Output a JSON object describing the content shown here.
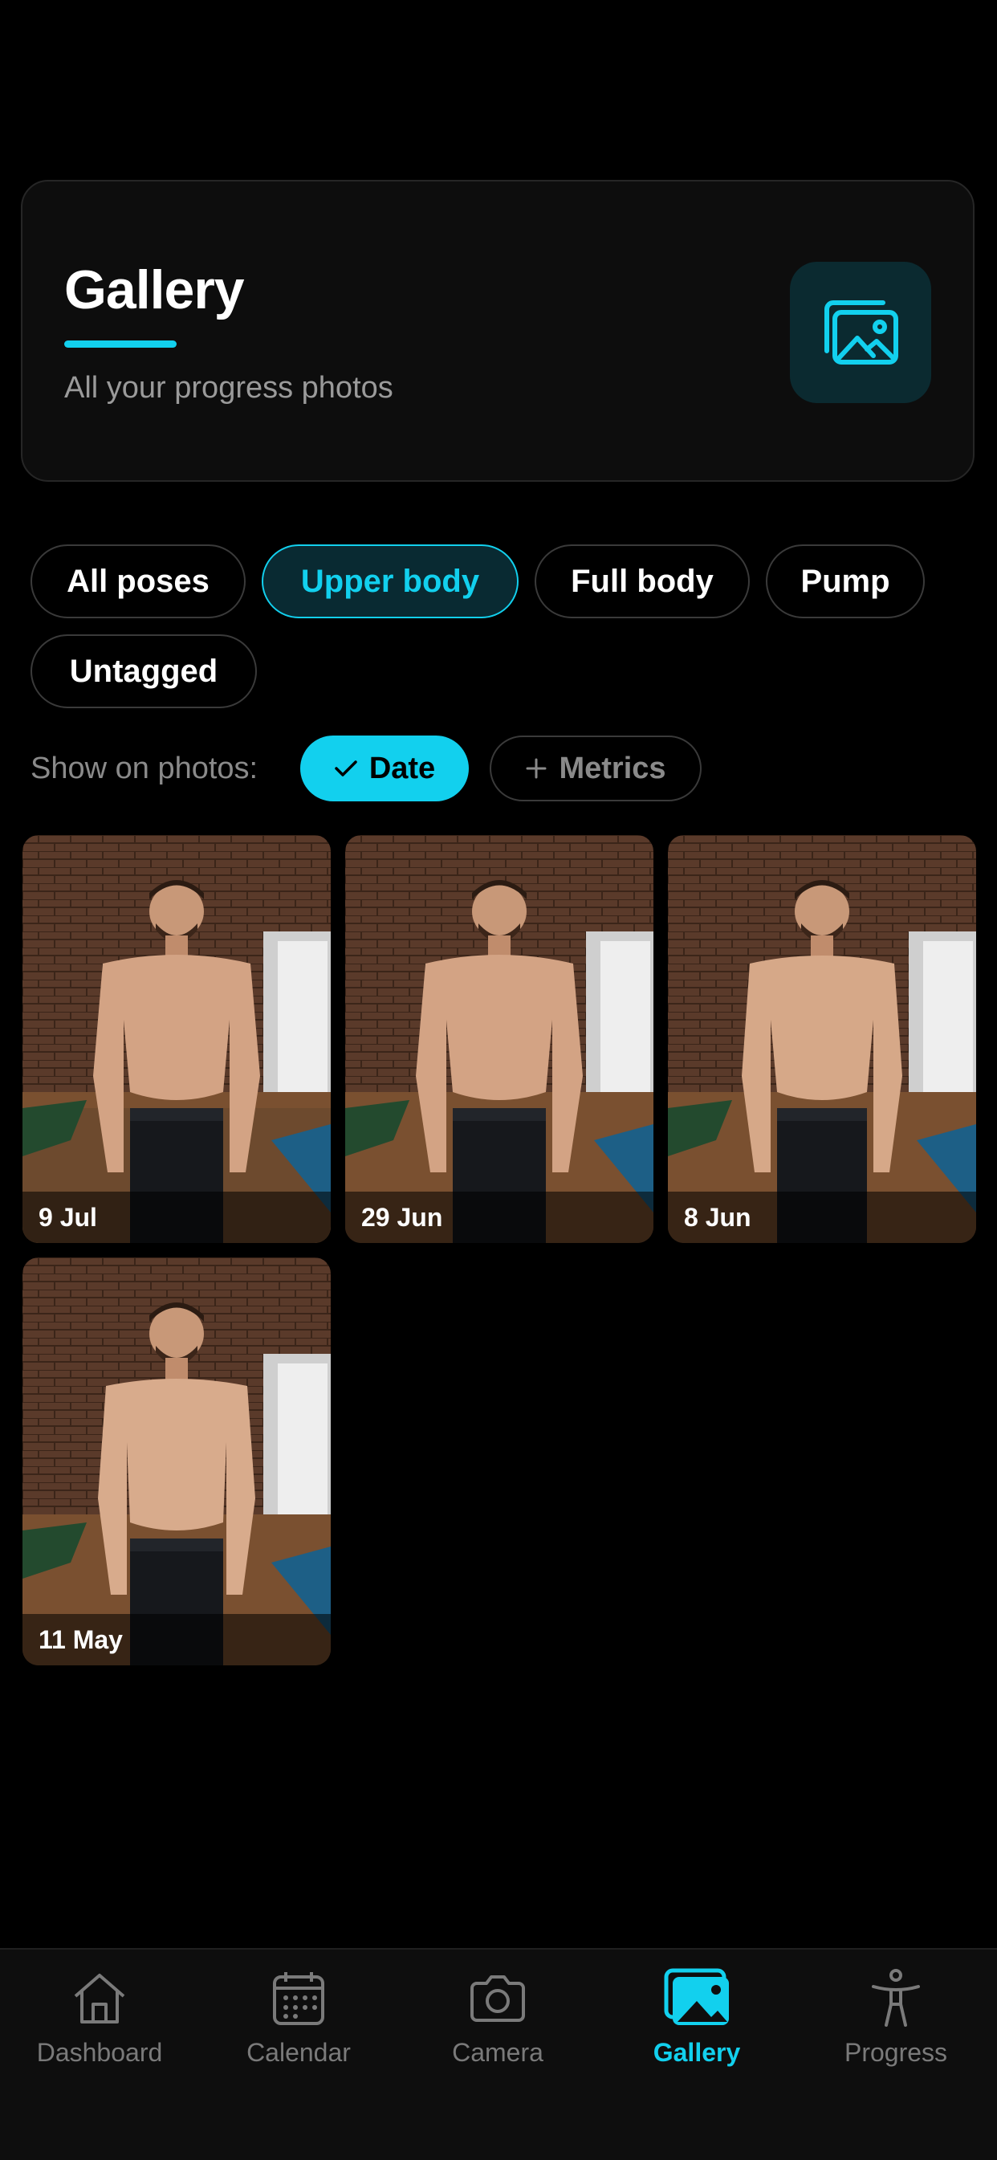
{
  "header": {
    "title": "Gallery",
    "subtitle": "All your progress photos",
    "icon": "gallery-icon"
  },
  "filters": [
    {
      "label": "All poses",
      "active": false
    },
    {
      "label": "Upper body",
      "active": true
    },
    {
      "label": "Full body",
      "active": false
    },
    {
      "label": "Pump",
      "active": false
    },
    {
      "label": "Untagged",
      "active": false
    }
  ],
  "show_on_photos": {
    "label": "Show on photos:",
    "date_label": "Date",
    "date_on": true,
    "metrics_label": "Metrics",
    "metrics_on": false
  },
  "photos": [
    {
      "date": "9 Jul"
    },
    {
      "date": "29 Jun"
    },
    {
      "date": "8 Jun"
    },
    {
      "date": "11 May"
    }
  ],
  "tabs": [
    {
      "label": "Dashboard",
      "icon": "home-icon"
    },
    {
      "label": "Calendar",
      "icon": "calendar-icon"
    },
    {
      "label": "Camera",
      "icon": "camera-icon"
    },
    {
      "label": "Gallery",
      "icon": "gallery-icon",
      "active": true
    },
    {
      "label": "Progress",
      "icon": "person-icon"
    }
  ],
  "colors": {
    "accent": "#12d0ee",
    "background": "#000000",
    "card": "#0d0d0d"
  }
}
